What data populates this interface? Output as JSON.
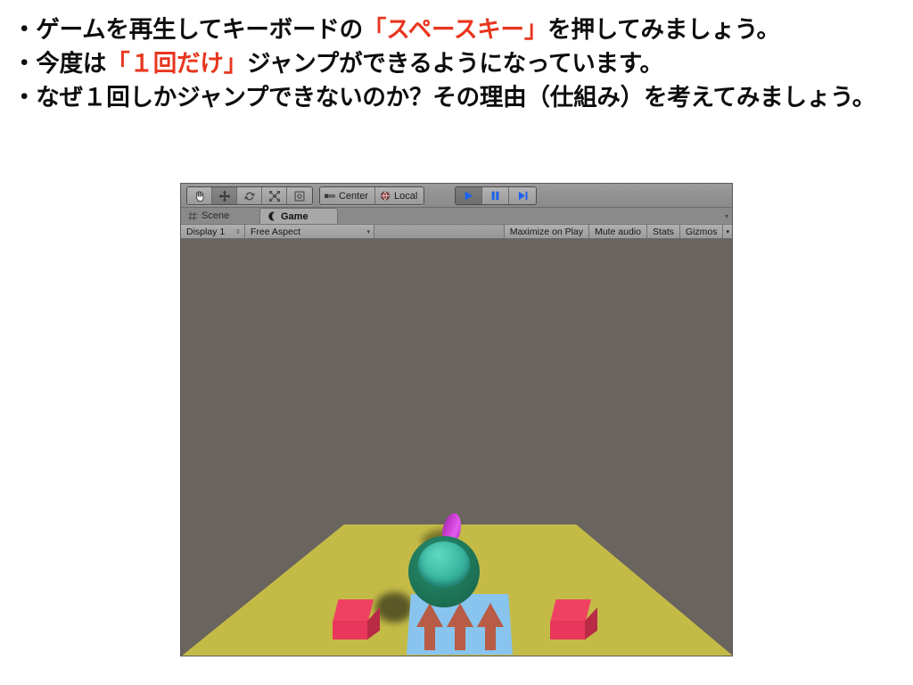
{
  "slide": {
    "lines": [
      {
        "id": "line1",
        "segments": [
          {
            "text": "・ゲームを再生してキーボードの",
            "accent": false
          },
          {
            "text": "「スペースキー」",
            "accent": true
          },
          {
            "text": "を押してみましょう。",
            "accent": false
          }
        ]
      },
      {
        "id": "line2",
        "segments": [
          {
            "text": "・今度は",
            "accent": false
          },
          {
            "text": "「１回だけ」",
            "accent": true
          },
          {
            "text": "ジャンプができるようになっています。",
            "accent": false
          }
        ]
      },
      {
        "id": "line3",
        "segments": [
          {
            "text": "・なぜ１回しかジャンプできないのか？その理由（仕組み）を考えてみましょう。",
            "accent": false
          }
        ]
      }
    ],
    "line1_part1": "・ゲームを再生してキーボードの",
    "line1_accent": "「スペースキー」",
    "line1_part2": "を押してみましょう。",
    "line2_part1": "・今度は",
    "line2_accent": "「１回だけ」",
    "line2_part2": "ジャンプができるようになっています。",
    "line3_text": "・なぜ１回しかジャンプできないのか？その理由（仕組み）を考えてみましょう。"
  },
  "editor": {
    "toolbar": {
      "transform_tools": [
        {
          "name": "hand-tool",
          "label": "Hand",
          "active": false
        },
        {
          "name": "move-tool",
          "label": "Move",
          "active": true
        },
        {
          "name": "rotate-tool",
          "label": "Rotate",
          "active": false
        },
        {
          "name": "scale-tool",
          "label": "Scale",
          "active": false
        },
        {
          "name": "rect-tool",
          "label": "Rect",
          "active": false
        }
      ],
      "pivot_mode_label": "Center",
      "pivot_rotation_label": "Local",
      "playback": [
        {
          "name": "play-button",
          "label": "Play",
          "engaged": true
        },
        {
          "name": "pause-button",
          "label": "Pause",
          "engaged": false
        },
        {
          "name": "step-button",
          "label": "Step",
          "engaged": false
        }
      ]
    },
    "tabs": [
      {
        "id": "scene",
        "label": "Scene",
        "active": false
      },
      {
        "id": "game",
        "label": "Game",
        "active": true
      }
    ],
    "game_view_bar": {
      "display_label": "Display 1",
      "aspect_label": "Free Aspect",
      "maximize_label": "Maximize on Play",
      "mute_label": "Mute audio",
      "stats_label": "Stats",
      "gizmos_label": "Gizmos"
    },
    "colors": {
      "background": "#6a645f",
      "platform": "#c4bb47",
      "player_outer": "#1f7a5c",
      "player_inner": "#38b5a0",
      "player_ring": "#cf3fd4",
      "cube": "#e8375a",
      "jump_pad": "#88c4ed",
      "pad_arrow": "#b85c46",
      "accent_red": "#e8361e"
    },
    "scene_objects": [
      {
        "name": "player-sphere",
        "color": "#1f7a5c"
      },
      {
        "name": "player-ring",
        "color": "#cf3fd4"
      },
      {
        "name": "jump-pad",
        "color": "#88c4ed"
      },
      {
        "name": "cube-left",
        "color": "#e8375a"
      },
      {
        "name": "cube-right",
        "color": "#e8375a"
      },
      {
        "name": "ground-platform",
        "color": "#c4bb47"
      }
    ]
  }
}
